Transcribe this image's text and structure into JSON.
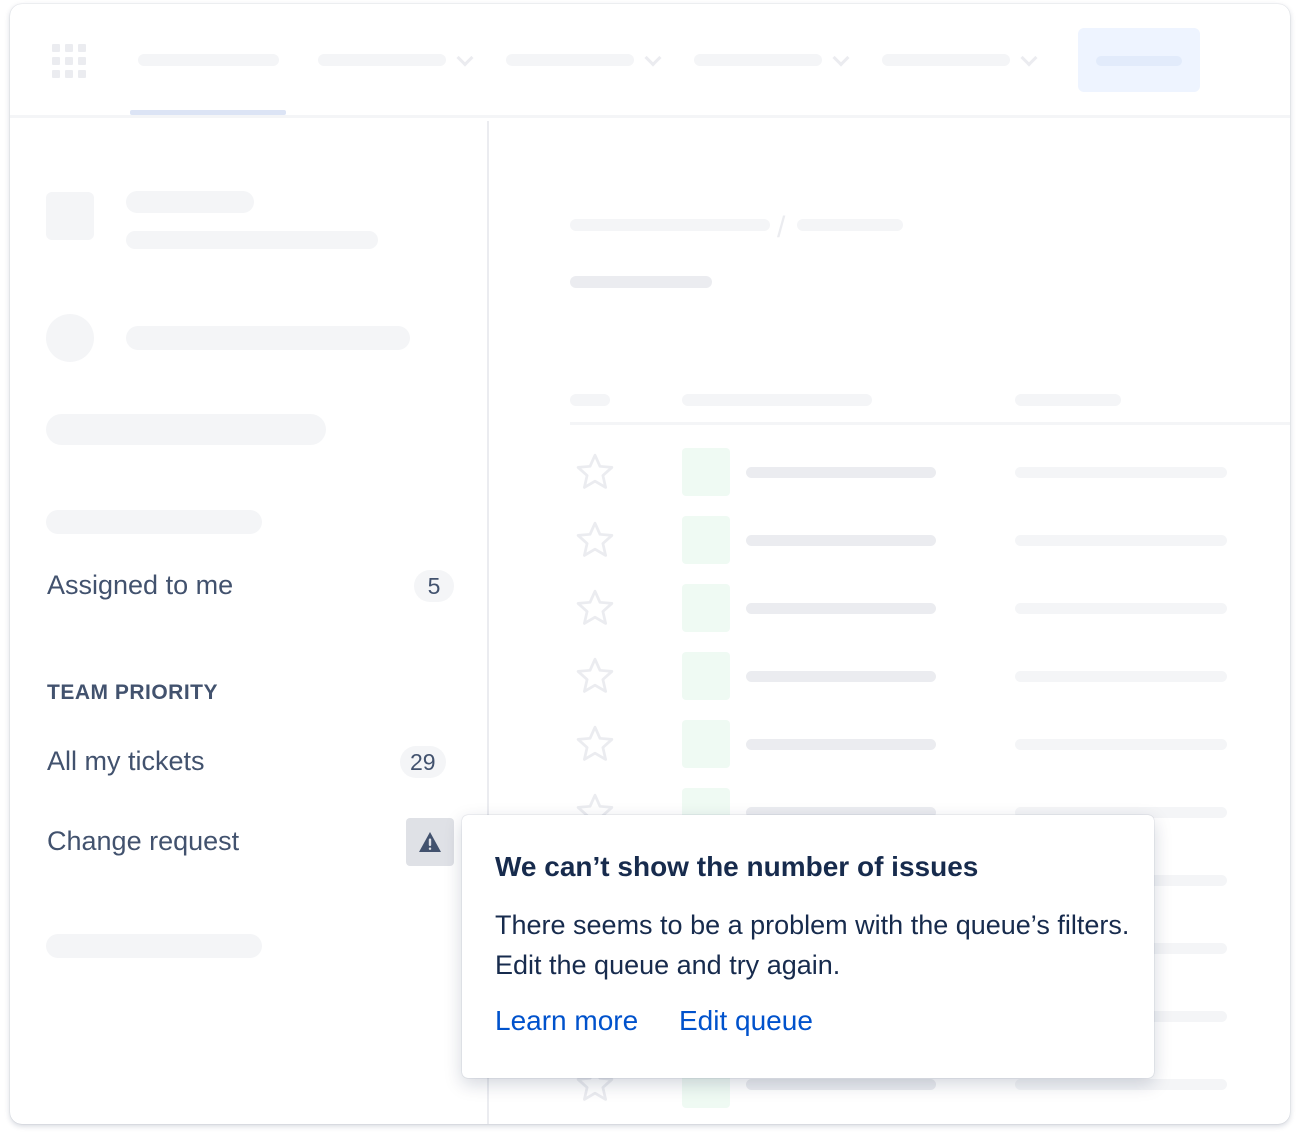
{
  "sidebar": {
    "assigned_label": "Assigned to me",
    "assigned_count": "5",
    "section_heading": "TEAM PRIORITY",
    "queues": [
      {
        "label": "All my tickets",
        "count": "29"
      },
      {
        "label": "Change request",
        "status_icon": "warning-icon"
      }
    ]
  },
  "popup": {
    "title": "We can’t show the number of issues",
    "body": "There seems to be a problem with the queue’s filters. Edit the queue and try again.",
    "learn_more": "Learn more",
    "edit_queue": "Edit queue"
  },
  "colors": {
    "link": "#0052cc",
    "text_dark": "#172b4d",
    "text_secondary": "#42526e",
    "warning_button_bg": "#dfe1e6"
  }
}
